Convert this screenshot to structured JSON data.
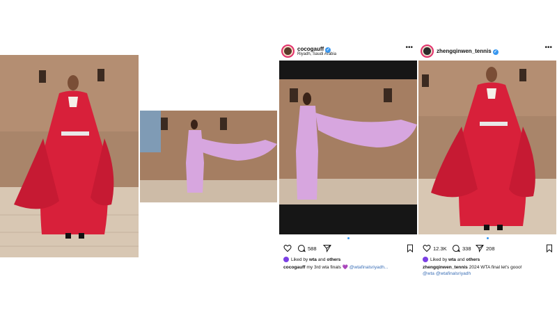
{
  "posts": [
    {
      "username": "cocogauff",
      "location": "Riyadh, Saudi Arabia",
      "likes": "588",
      "comments": "",
      "shares": "",
      "liked_by_prefix": "Liked by",
      "liked_by_user": "wta",
      "liked_by_and": "and",
      "liked_by_others": "others",
      "caption_text": "my 3rd wta finals",
      "caption_emoji": "💜",
      "caption_tag": "@wtafinalsriyadh...",
      "caption_tag2": ""
    },
    {
      "username": "zhengqinwen_tennis",
      "location": "",
      "likes": "12.3K",
      "comments": "338",
      "shares": "208",
      "liked_by_prefix": "Liked by",
      "liked_by_user": "wta",
      "liked_by_and": "and",
      "liked_by_others": "others",
      "caption_text": "2024 WTA final let's gooo!",
      "caption_emoji": "",
      "caption_tag": "@wta",
      "caption_tag2": "@wtafinalsriyadh"
    }
  ],
  "icons": {
    "like": "heart-icon",
    "comment": "comment-icon",
    "share": "send-icon",
    "save": "bookmark-icon",
    "more": "more-icon",
    "verified": "verified-icon"
  },
  "colors": {
    "accent_blue": "#3897f0",
    "tag_blue": "#3b6fb6",
    "red_dress": "#d8203a",
    "lilac_dress": "#d7a6df",
    "wall": "#a98266"
  }
}
